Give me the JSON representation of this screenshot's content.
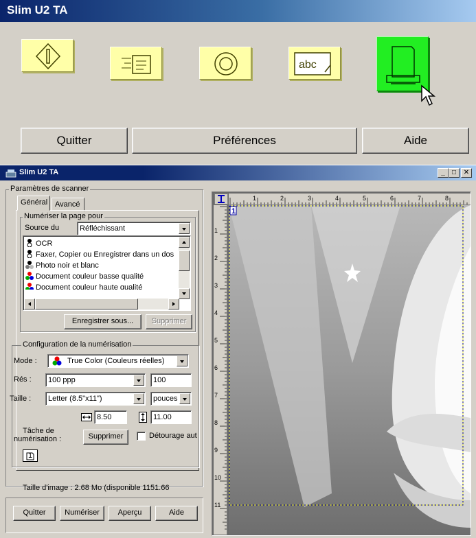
{
  "launcher": {
    "title": "Slim U2 TA",
    "tools": [
      {
        "name": "scan-tool",
        "icon": "diamond-start-icon"
      },
      {
        "name": "fax-tool",
        "icon": "fax-icon"
      },
      {
        "name": "copy-tool",
        "icon": "circle-target-icon"
      },
      {
        "name": "ocr-tool",
        "icon": "abc-ocr-icon"
      },
      {
        "name": "document-tool",
        "icon": "document-printer-icon"
      }
    ],
    "buttons": {
      "quit": "Quitter",
      "preferences": "Préférences",
      "help": "Aide"
    }
  },
  "window": {
    "title": "Slim U2 TA",
    "caption_buttons": {
      "minimize": "_",
      "maximize": "□",
      "close": "✕"
    },
    "scanner_group": "Paramètres de scanner",
    "tabs": [
      "Général",
      "Avancé"
    ],
    "scan_page_group": "Numériser la page pour",
    "source_label": "Source du",
    "source_value": "Réfléchissant",
    "list_items": [
      "OCR",
      "Faxer, Copier ou Enregistrer dans un dos",
      "Photo noir et blanc",
      "Document couleur basse qualité",
      "Document couleur haute qualité"
    ],
    "save_as": "Enregistrer sous...",
    "delete": "Supprimer",
    "config_group": "Configuration de la numérisation",
    "mode_label": "Mode :",
    "mode_value": "True Color (Couleurs réelles)",
    "res_label": "Rés :",
    "res_value": "100 ppp",
    "res_custom": "100",
    "size_label": "Taille :",
    "size_value": "Letter (8.5\"x11\")",
    "unit_value": "pouces",
    "width_value": "8.50",
    "height_value": "11.00",
    "task_label_1": "Tâche de",
    "task_label_2": "numérisation :",
    "task_delete": "Supprimer",
    "crop_label": "Détourage aut",
    "task_number": "1",
    "image_size": "Taille d'image : 2.68 Mo (disponible 1151.66",
    "bottom_buttons": {
      "quit": "Quitter",
      "scan": "Numériser",
      "preview": "Aperçu",
      "help": "Aide"
    },
    "ruler_h": [
      "1",
      "2",
      "3",
      "4",
      "5",
      "6",
      "7",
      "8"
    ],
    "ruler_v": [
      "1",
      "2",
      "3",
      "4",
      "5",
      "6",
      "7",
      "8",
      "9",
      "10",
      "11"
    ],
    "frame_marker": "1"
  }
}
